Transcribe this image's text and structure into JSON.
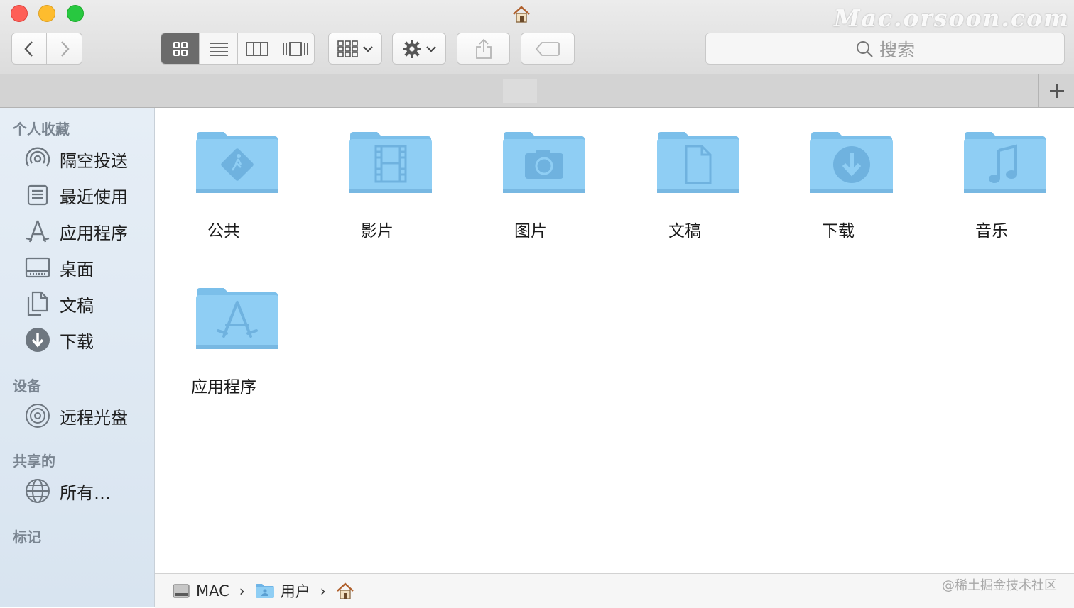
{
  "titlebar": {
    "watermark": "Mac.orsoon.com",
    "home_icon": "home-icon"
  },
  "toolbar": {
    "back_icon": "chevron-left-icon",
    "forward_icon": "chevron-right-icon",
    "view_modes": [
      "icon-view",
      "list-view",
      "column-view",
      "cover-flow-view"
    ],
    "active_view": "icon-view",
    "group_icon": "group-grid-icon",
    "action_icon": "gear-icon",
    "share_icon": "share-icon",
    "tag_icon": "tag-icon",
    "search_placeholder": "搜索"
  },
  "tabbar": {
    "add_icon": "plus-icon"
  },
  "sidebar": {
    "sections": [
      {
        "header": "个人收藏",
        "items": [
          {
            "label": "隔空投送",
            "icon": "airdrop-icon"
          },
          {
            "label": "最近使用",
            "icon": "recents-icon"
          },
          {
            "label": "应用程序",
            "icon": "applications-icon"
          },
          {
            "label": "桌面",
            "icon": "desktop-icon"
          },
          {
            "label": "文稿",
            "icon": "documents-icon"
          },
          {
            "label": "下载",
            "icon": "download-icon"
          }
        ]
      },
      {
        "header": "设备",
        "items": [
          {
            "label": "远程光盘",
            "icon": "disc-icon"
          }
        ]
      },
      {
        "header": "共享的",
        "items": [
          {
            "label": "所有…",
            "icon": "network-globe-icon"
          }
        ]
      },
      {
        "header": "标记",
        "items": []
      }
    ]
  },
  "folders": [
    {
      "label": "公共",
      "icon": "public-folder-icon"
    },
    {
      "label": "影片",
      "icon": "movies-folder-icon"
    },
    {
      "label": "图片",
      "icon": "pictures-folder-icon"
    },
    {
      "label": "文稿",
      "icon": "documents-folder-icon"
    },
    {
      "label": "下载",
      "icon": "downloads-folder-icon"
    },
    {
      "label": "音乐",
      "icon": "music-folder-icon"
    },
    {
      "label": "应用程序",
      "icon": "applications-folder-icon"
    }
  ],
  "pathbar": {
    "crumbs": [
      {
        "label": "MAC",
        "icon": "hard-drive-icon"
      },
      {
        "label": "用户",
        "icon": "users-folder-icon"
      },
      {
        "label": "",
        "icon": "home-icon"
      }
    ],
    "separator": "›",
    "watermark": "@稀土掘金技术社区"
  },
  "colors": {
    "folder_blue": "#8ccdf3",
    "folder_tab": "#78bce9",
    "sidebar_bg": "#dde8f2",
    "active_segment": "#6b6b6b"
  }
}
